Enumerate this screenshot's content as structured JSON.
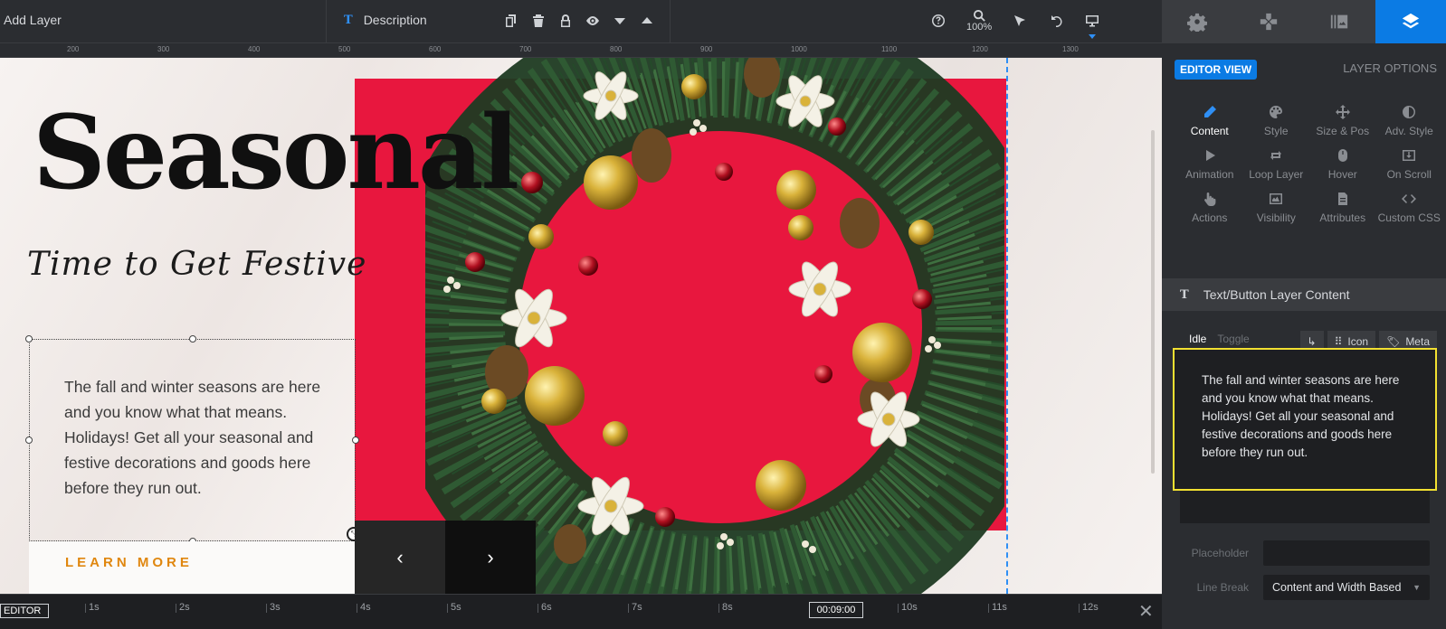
{
  "toolbar": {
    "add_layer": "Add Layer",
    "layer_name": "Description",
    "zoom": "100%"
  },
  "ruler": {
    "ticks": [
      "200",
      "300",
      "400",
      "500",
      "600",
      "700",
      "800",
      "900",
      "1000",
      "1100",
      "1200",
      "1300"
    ]
  },
  "canvas": {
    "headline": "Seasonal",
    "script": "Time to Get Festive",
    "description": "The fall and winter seasons are here and you know what that means. Holidays! Get all your seasonal and festive decorations and goods here before they run out.",
    "cta": "LEARN MORE",
    "prev_arrow": "‹",
    "next_arrow": "›",
    "accent_red": "#e8173e",
    "cta_color": "#e0870f"
  },
  "timeline": {
    "mode": "EDITOR",
    "ticks": [
      "1s",
      "2s",
      "3s",
      "4s",
      "5s",
      "6s",
      "7s",
      "8s",
      "10s",
      "11s",
      "12s"
    ],
    "time": "00:09:00"
  },
  "panel": {
    "editor_view": "EDITOR VIEW",
    "layer_options": "LAYER OPTIONS",
    "options": [
      {
        "label": "Content",
        "icon": "pencil-icon",
        "active": true
      },
      {
        "label": "Style",
        "icon": "palette-icon"
      },
      {
        "label": "Size & Pos",
        "icon": "move-icon"
      },
      {
        "label": "Adv. Style",
        "icon": "contrast-icon"
      },
      {
        "label": "Animation",
        "icon": "play-icon"
      },
      {
        "label": "Loop Layer",
        "icon": "loop-icon"
      },
      {
        "label": "Hover",
        "icon": "mouse-icon"
      },
      {
        "label": "On Scroll",
        "icon": "scroll-icon"
      },
      {
        "label": "Actions",
        "icon": "hand-pointer-icon"
      },
      {
        "label": "Visibility",
        "icon": "visibility-icon"
      },
      {
        "label": "Attributes",
        "icon": "document-icon"
      },
      {
        "label": "Custom CSS",
        "icon": "code-icon"
      }
    ],
    "section_title": "Text/Button Layer Content",
    "idle": "Idle",
    "toggle": "Toggle",
    "icon_btn": "Icon",
    "meta_btn": "Meta",
    "content_text": "The fall and winter seasons are here and you know what that means. Holidays! Get all your seasonal and festive decorations and goods here before they run out.",
    "placeholder_label": "Placeholder",
    "placeholder_value": "",
    "linebreak_label": "Line Break",
    "linebreak_value": "Content and Width Based",
    "accent_blue": "#0b7be4",
    "highlight_yellow": "#f2e031"
  }
}
